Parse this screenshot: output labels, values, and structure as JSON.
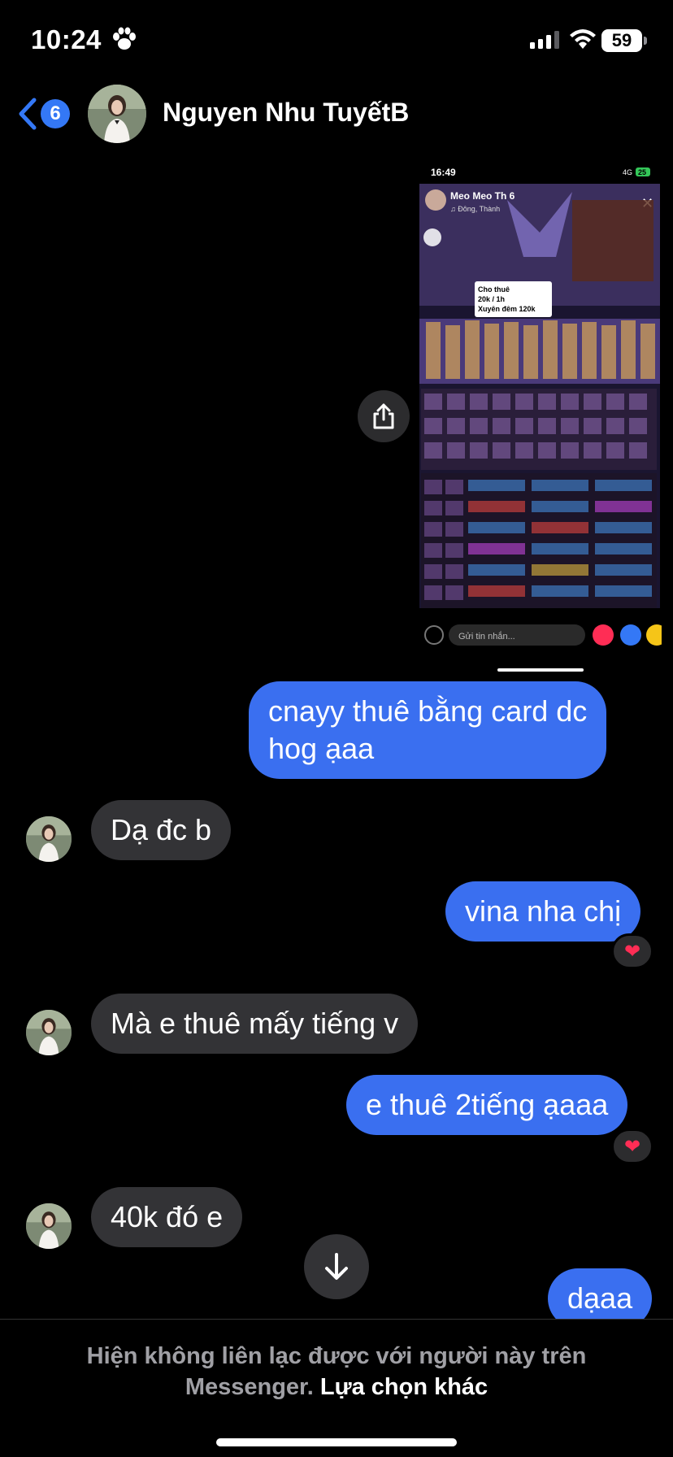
{
  "status_bar": {
    "time": "10:24",
    "battery": "59",
    "paw_icon": "paw-icon",
    "signal_icon": "cellular-signal-icon",
    "wifi_icon": "wifi-icon"
  },
  "header": {
    "back_badge": "6",
    "contact_name": "Nguyen Nhu TuyếtB",
    "accent_color": "#3478f6"
  },
  "shared_image": {
    "time": "16:49",
    "network": "4G",
    "battery": "25",
    "profile_name": "Meo Meo Th 6",
    "profile_sub": "♫ Đông, Thành",
    "note_line1": "Cho thuê",
    "note_line2": "20k / 1h",
    "note_line3": "Xuyên đêm 120k",
    "input_placeholder": "Gửi tin nhắn..."
  },
  "messages": [
    {
      "direction": "out",
      "text_line1": "cnayy thuê bằng card dc",
      "text_line2": "hog ạaa"
    },
    {
      "direction": "in",
      "text": "Dạ đc b"
    },
    {
      "direction": "out",
      "text": "vina nha chị",
      "reaction": "❤"
    },
    {
      "direction": "in",
      "text": "Mà e thuê mấy tiếng v"
    },
    {
      "direction": "out",
      "text": "e thuê 2tiếng ạaaa",
      "reaction": "❤"
    },
    {
      "direction": "in",
      "text": "40k đó e"
    },
    {
      "direction": "out",
      "text": "dạaa"
    }
  ],
  "footer": {
    "notice_text": "Hiện không liên lạc được với người này trên Messenger.",
    "link_text": "Lựa chọn khác"
  },
  "colors": {
    "outgoing_bubble": "#3a6ff0",
    "incoming_bubble": "#333336",
    "background": "#000000",
    "reaction_heart": "#ff2d55"
  }
}
